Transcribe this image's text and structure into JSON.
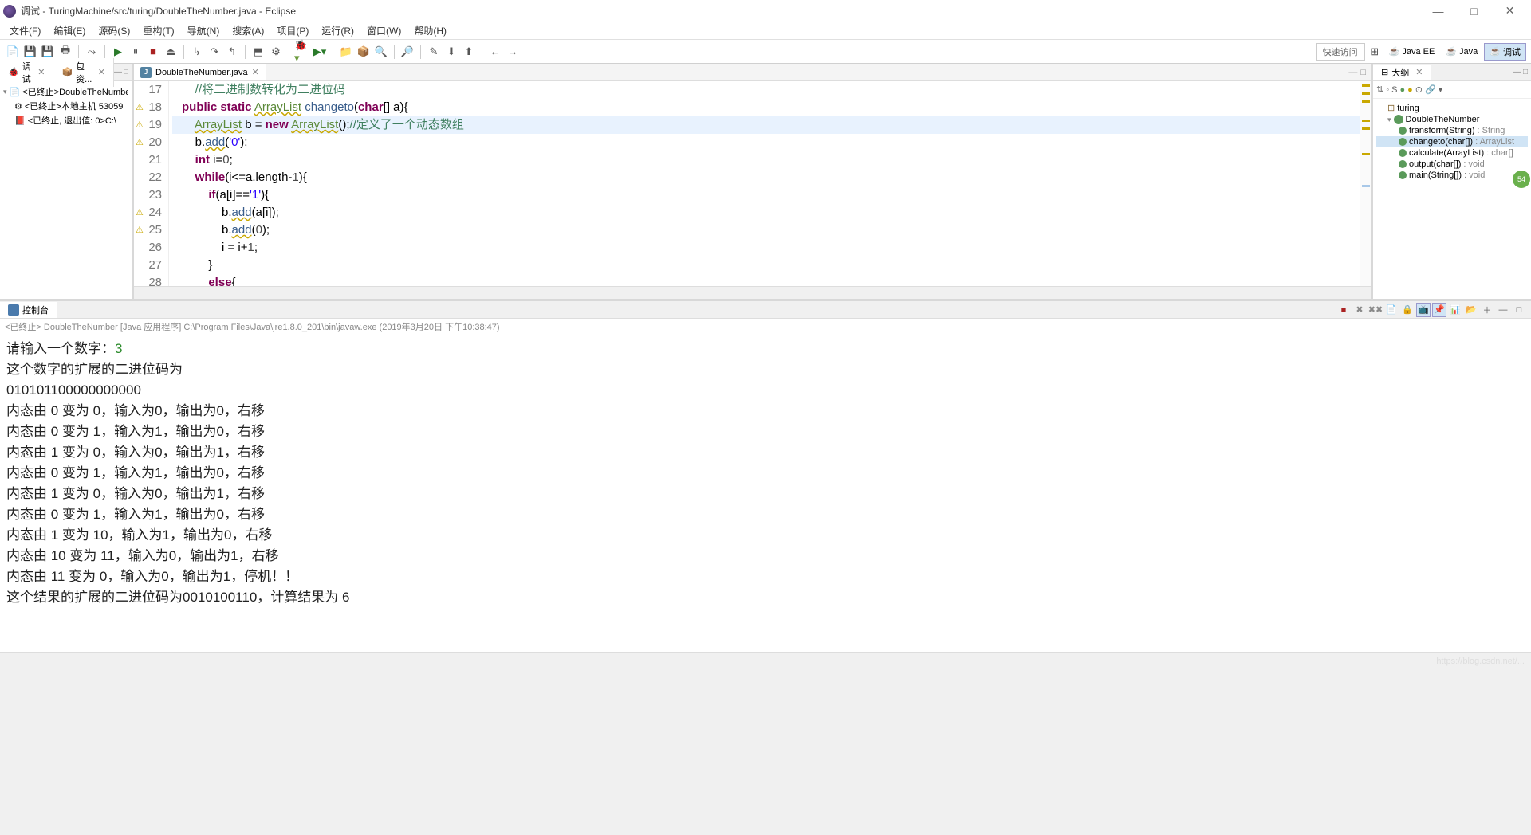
{
  "window": {
    "title": "调试 - TuringMachine/src/turing/DoubleTheNumber.java - Eclipse"
  },
  "menu": [
    "文件(F)",
    "编辑(E)",
    "源码(S)",
    "重构(T)",
    "导航(N)",
    "搜索(A)",
    "项目(P)",
    "运行(R)",
    "窗口(W)",
    "帮助(H)"
  ],
  "toolbar": {
    "quick_access": "快速访问",
    "perspectives": [
      {
        "label": "Java EE",
        "active": false
      },
      {
        "label": "Java",
        "active": false
      },
      {
        "label": "调试",
        "active": true
      }
    ]
  },
  "debug_view": {
    "tabs": [
      {
        "label": "调试",
        "icon": "🐞"
      },
      {
        "label": "包资...",
        "icon": "📦"
      }
    ],
    "tree": [
      {
        "indent": 0,
        "twisty": "▾",
        "icon": "📄",
        "text": "<已终止>DoubleTheNumbe"
      },
      {
        "indent": 1,
        "twisty": "",
        "icon": "⚙",
        "text": "<已终止>本地主机 53059"
      },
      {
        "indent": 1,
        "twisty": "",
        "icon": "📕",
        "text": "<已终止, 退出值: 0>C:\\"
      }
    ]
  },
  "editor": {
    "tab_label": "DoubleTheNumber.java",
    "lines": [
      {
        "n": 17,
        "warn": false,
        "html": "    <span class='cmt'>//将二进制数转化为二进位码</span>"
      },
      {
        "n": 18,
        "warn": true,
        "html": "<span class='kw'>public static</span> <span class='typ war'>ArrayList</span> <span class='fn'>changeto</span>(<span class='kw'>char</span>[] a){"
      },
      {
        "n": 19,
        "warn": true,
        "hl": true,
        "html": "    <span class='typ war'>ArrayList</span> b = <span class='kw'>new</span> <span class='typ war'>ArrayList</span>();<span class='cmt'>//定义了一个动态数组</span>"
      },
      {
        "n": 20,
        "warn": true,
        "html": "    b.<span class='fn war'>add</span>(<span class='str'>'0'</span>);"
      },
      {
        "n": 21,
        "warn": false,
        "html": "    <span class='kw'>int</span> i=<span class='num'>0</span>;"
      },
      {
        "n": 22,
        "warn": false,
        "html": "    <span class='kw'>while</span>(i&lt;=a.<span>length</span>-<span class='num'>1</span>){"
      },
      {
        "n": 23,
        "warn": false,
        "html": "        <span class='kw'>if</span>(a[i]==<span class='str'>'1'</span>){"
      },
      {
        "n": 24,
        "warn": true,
        "html": "            b.<span class='fn war'>add</span>(a[i]);"
      },
      {
        "n": 25,
        "warn": true,
        "html": "            b.<span class='fn war'>add</span>(<span class='num'>0</span>);"
      },
      {
        "n": 26,
        "warn": false,
        "html": "            i = i+<span class='num'>1</span>;"
      },
      {
        "n": 27,
        "warn": false,
        "html": "        }"
      },
      {
        "n": 28,
        "warn": false,
        "html": "        <span class='kw'>else</span>{"
      }
    ]
  },
  "outline": {
    "tab_label": "大纲",
    "items": [
      {
        "lvl": 1,
        "ico": "pkg",
        "label": "turing"
      },
      {
        "lvl": 1,
        "ico": "cls",
        "twisty": "▾",
        "label": "DoubleTheNumber"
      },
      {
        "lvl": 2,
        "ico": "mth",
        "label": "transform(String)",
        "ret": " : String"
      },
      {
        "lvl": 2,
        "ico": "mth",
        "label": "changeto(char[])",
        "ret": " : ArrayList",
        "sel": true
      },
      {
        "lvl": 2,
        "ico": "mth",
        "label": "calculate(ArrayList)",
        "ret": " : char[]"
      },
      {
        "lvl": 2,
        "ico": "mth",
        "label": "output(char[])",
        "ret": " : void"
      },
      {
        "lvl": 2,
        "ico": "mth",
        "label": "main(String[])",
        "ret": " : void"
      }
    ],
    "badge": "54"
  },
  "console": {
    "tab_label": "控制台",
    "info": "<已终止> DoubleTheNumber [Java 应用程序] C:\\Program Files\\Java\\jre1.8.0_201\\bin\\javaw.exe (2019年3月20日 下午10:38:47)",
    "lines": [
      {
        "prefix": "请输入一个数字：",
        "input": "3"
      },
      {
        "text": "这个数字的扩展的二进位码为"
      },
      {
        "text": "010101100000000000"
      },
      {
        "text": "内态由 0  变为 0，输入为0，输出为0，右移"
      },
      {
        "text": "内态由 0  变为 1，输入为1，输出为0，右移"
      },
      {
        "text": "内态由 1  变为 0，输入为0，输出为1，右移"
      },
      {
        "text": "内态由 0  变为 1，输入为1，输出为0，右移"
      },
      {
        "text": "内态由 1  变为 0，输入为0，输出为1，右移"
      },
      {
        "text": "内态由 0  变为 1，输入为1，输出为0，右移"
      },
      {
        "text": "内态由 1  变为 10，输入为1，输出为0，右移"
      },
      {
        "text": "内态由 10  变为 11，输入为0，输出为1，右移"
      },
      {
        "text": "内态由 11  变为 0，输入为0，输出为1，停机！！"
      },
      {
        "text": "这个结果的扩展的二进位码为0010100110，计算结果为 6"
      }
    ]
  },
  "watermark": "https://blog.csdn.net/..."
}
